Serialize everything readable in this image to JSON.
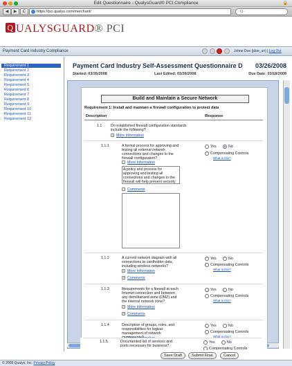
{
  "browser": {
    "window_title": "Edit Questionnaire - QualysGuard® PCI Compliance",
    "url": "https://pci.qualys.com/merchant/",
    "search_placeholder": "Q-",
    "back_icon": "◀",
    "forward_icon": "▶",
    "reload_icon": "C"
  },
  "brand": {
    "logo_q": "Q",
    "logo_text": "UALYSGUARD",
    "logo_suffix": "® PCI"
  },
  "subnav": {
    "title": "Payment Card Industry Compliance",
    "user": "Johne Doe (jdoe_un) |",
    "logout": "Log Out"
  },
  "sidebar": {
    "items": [
      "Requirement 1",
      "Requirement 2",
      "Requirement 3",
      "Requirement 4",
      "Requirement 5",
      "Requirement 6",
      "Requirement 7",
      "Requirement 8",
      "Requirement 9",
      "Requirement 10",
      "Requirement 11",
      "Requirement 12"
    ],
    "active_index": 0
  },
  "questionnaire": {
    "title": "Payment Card Industry Self-Assessment Questionnaire D",
    "date": "03/26/2008",
    "started": "Started: 03/26/2008",
    "last_edited": "Last Edited: 03/26/2008",
    "due_date": "Due Date: 03/18/2009"
  },
  "sheet": {
    "section_title": "Build and Maintain a Secure Network",
    "requirement_heading": "Requirement 1: Install and maintain a firewall configuration to protect data",
    "col_description": "Description",
    "col_response": "Response",
    "more_info_label": "More Information",
    "comments_label": "Comments",
    "yes_label": "Yes",
    "no_label": "No",
    "comp_label": "Compensating Controls",
    "whatis_label": "What is this?",
    "plus_symbol": "+",
    "minus_symbol": "−",
    "q_1_1_num": "1.1",
    "q_1_1_text": "Do established firewall configuration standards include the following?",
    "q_1_1_1_num": "1.1.1",
    "q_1_1_1_text": "A formal process for approving and testing all external network connections and changes to the firewall configuration?",
    "q_1_1_1_info": "A policy and process for approving and testing all connections and changes to the firewall will help prevent security problems caused by",
    "q_1_1_2_num": "1.1.2",
    "q_1_1_2_text": "A current network diagram with all connections to cardholder data, including wireless networks?",
    "q_1_1_3_num": "1.1.3",
    "q_1_1_3_text": "Requirements for a firewall at each Internet connection and between any demilitarized zone (DMZ) and the internal network zone?",
    "q_1_1_4_num": "1.1.4",
    "q_1_1_4_text": "Description of groups, roles, and responsibilities for logical management of network components?",
    "q_1_1_5_num": "1.1.5",
    "q_1_1_5_text": "Documented list of services and ports necessary for business?"
  },
  "footer": {
    "save_draft": "Save Draft",
    "submit_final": "Submit Final",
    "cancel": "Cancel",
    "copyright": "© 2008 Qualys, Inc.",
    "privacy": "Privacy Policy"
  }
}
